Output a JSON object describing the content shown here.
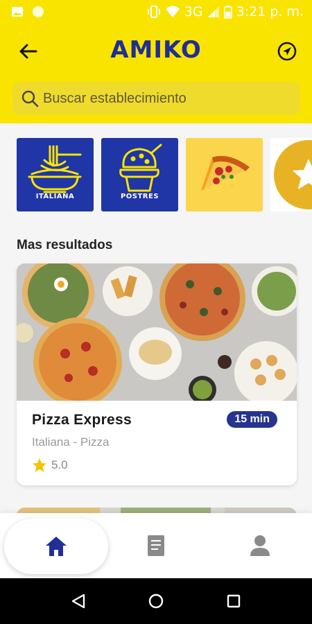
{
  "status_bar": {
    "network": "3G",
    "time": "3:21 p. m."
  },
  "header": {
    "title": "AMIKO",
    "search_placeholder": "Buscar establecimiento"
  },
  "categories": [
    {
      "label": "ITALIANA",
      "icon": "spaghetti-icon"
    },
    {
      "label": "POSTRES",
      "icon": "ice-cream-icon"
    },
    {
      "label": "",
      "icon": "pizza-icon"
    },
    {
      "label": "",
      "icon": "star-badge-icon"
    }
  ],
  "section_title": "Mas resultados",
  "restaurants": [
    {
      "name": "Pizza Express",
      "time": "15 min",
      "categories": "Italiana -  Pizza",
      "rating": "5.0"
    }
  ],
  "bottom_nav": {
    "items": [
      "home-icon",
      "orders-icon",
      "profile-icon"
    ],
    "active": "home"
  },
  "colors": {
    "brand_yellow": "#f9e400",
    "brand_blue": "#1f2f95",
    "star": "#f2c500"
  }
}
